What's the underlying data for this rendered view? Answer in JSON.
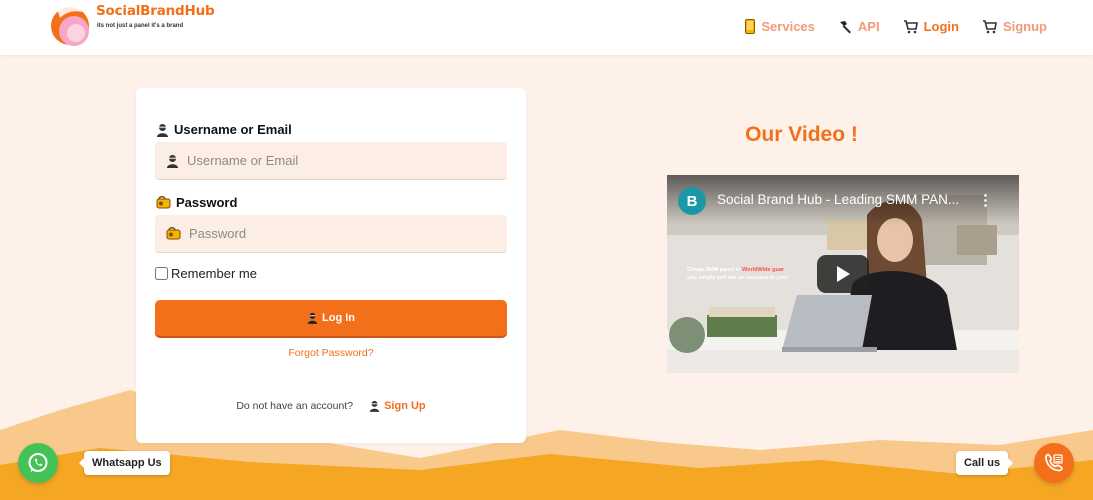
{
  "brand": {
    "name": "SocialBrandHub",
    "tagline": "its not just a panel it's a brand",
    "accent": "#f36f1a",
    "accent_light": "#f39a78",
    "background": "#fdf1e9"
  },
  "nav": {
    "items": [
      {
        "label": "Services",
        "icon": "phone-icon",
        "active": false
      },
      {
        "label": "API",
        "icon": "hammer-icon",
        "active": false
      },
      {
        "label": "Login",
        "icon": "cart-icon",
        "active": true
      },
      {
        "label": "Signup",
        "icon": "cart-icon",
        "active": false
      }
    ]
  },
  "login": {
    "username_label": "Username or Email",
    "username_placeholder": "Username or Email",
    "username_value": "",
    "password_label": "Password",
    "password_placeholder": "Password",
    "password_value": "",
    "remember_label": "Remember me",
    "remember_checked": false,
    "submit_label": "Log In",
    "forgot_label": "Forgot Password?",
    "no_account_text": "Do not have an account?",
    "signup_label": "Sign Up"
  },
  "video": {
    "heading": "Our Video !",
    "channel_initial": "B",
    "title": "Social Brand Hub - Leading SMM PAN...",
    "overlay_line1_a": "Cheap SMM panel in ",
    "overlay_line1_b": "WorldWide guar",
    "overlay_line2": "you simply will see an increase in your"
  },
  "floating": {
    "whatsapp_label": "Whatsapp Us",
    "call_label": "Call us"
  }
}
